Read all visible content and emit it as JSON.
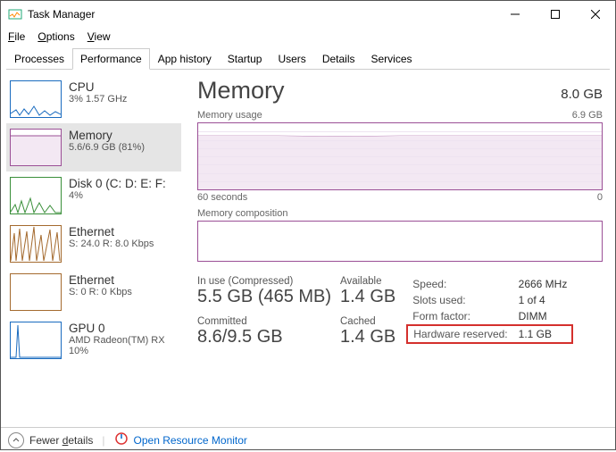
{
  "window": {
    "title": "Task Manager"
  },
  "menu": {
    "file": "File",
    "options": "Options",
    "view": "View"
  },
  "tabs": [
    "Processes",
    "Performance",
    "App history",
    "Startup",
    "Users",
    "Details",
    "Services"
  ],
  "active_tab": "Performance",
  "sidebar": {
    "items": [
      {
        "name": "CPU",
        "sub": "3%  1.57 GHz",
        "color": "#1a6bbf"
      },
      {
        "name": "Memory",
        "sub": "5.6/6.9 GB (81%)",
        "color": "#9b4f96"
      },
      {
        "name": "Disk 0 (C: D: E: F:",
        "sub": "4%",
        "color": "#3a8f3a"
      },
      {
        "name": "Ethernet",
        "sub": "S: 24.0  R: 8.0 Kbps",
        "color": "#a46a2e"
      },
      {
        "name": "Ethernet",
        "sub": "S: 0  R: 0 Kbps",
        "color": "#a46a2e"
      },
      {
        "name": "GPU 0",
        "sub": "AMD Radeon(TM) RX\n10%",
        "color": "#1a6bbf"
      }
    ]
  },
  "detail": {
    "title": "Memory",
    "total": "8.0 GB",
    "usage_label": "Memory usage",
    "usage_max": "6.9 GB",
    "x_left": "60 seconds",
    "x_right": "0",
    "comp_label": "Memory composition",
    "stats": {
      "in_use_label": "In use (Compressed)",
      "in_use": "5.5 GB (465 MB)",
      "available_label": "Available",
      "available": "1.4 GB",
      "committed_label": "Committed",
      "committed": "8.6/9.5 GB",
      "cached_label": "Cached",
      "cached": "1.4 GB"
    },
    "right": {
      "speed_label": "Speed:",
      "speed": "2666 MHz",
      "slots_label": "Slots used:",
      "slots": "1 of 4",
      "form_label": "Form factor:",
      "form": "DIMM",
      "hw_label": "Hardware reserved:",
      "hw": "1.1 GB"
    }
  },
  "footer": {
    "fewer": "Fewer details",
    "orm": "Open Resource Monitor"
  },
  "chart_data": {
    "type": "line",
    "title": "Memory usage",
    "xlabel": "seconds",
    "ylabel": "GB",
    "xlim": [
      60,
      0
    ],
    "ylim": [
      0,
      6.9
    ],
    "series": [
      {
        "name": "Memory",
        "values": [
          5.6,
          5.6,
          5.6,
          5.6,
          5.6,
          5.6,
          5.6,
          5.6,
          5.6,
          5.6
        ]
      }
    ],
    "x": [
      60,
      54,
      48,
      42,
      36,
      30,
      24,
      18,
      12,
      6
    ]
  }
}
